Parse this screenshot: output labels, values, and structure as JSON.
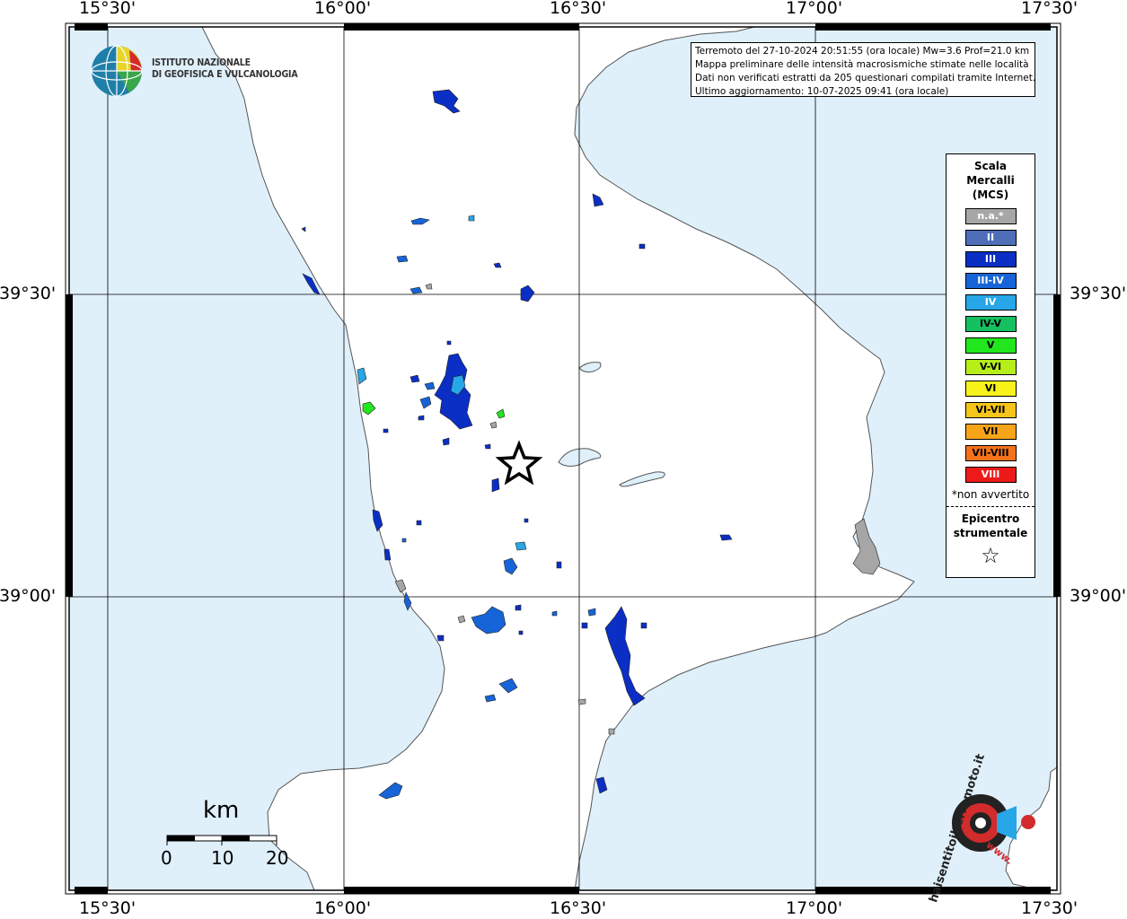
{
  "map": {
    "lon_labels": [
      "15°30'",
      "16°00'",
      "16°30'",
      "17°00'",
      "17°30'"
    ],
    "lat_labels": [
      "39°30'",
      "39°00'"
    ]
  },
  "info": {
    "line1": "Terremoto del 27-10-2024 20:51:55 (ora locale) Mw=3.6 Prof=21.0 km",
    "line2": "Mappa preliminare delle intensità macrosismiche stimate nelle località",
    "line3": "Dati non verificati estratti da 205 questionari compilati tramite Internet.",
    "line4": "Ultimo aggiornamento: 10-07-2025 09:41 (ora locale)"
  },
  "institute": {
    "line1": "ISTITUTO NAZIONALE",
    "line2": "DI GEOFISICA E VULCANOLOGIA"
  },
  "legend": {
    "title1": "Scala",
    "title2": "Mercalli",
    "title3": "(MCS)",
    "items": [
      {
        "label": "n.a.*",
        "color": "#a6a6a6",
        "text_color": "#ffffff"
      },
      {
        "label": "II",
        "color": "#4f6eb8",
        "text_color": "#ffffff"
      },
      {
        "label": "III",
        "color": "#0b2fc4",
        "text_color": "#ffffff"
      },
      {
        "label": "III-IV",
        "color": "#1764d8",
        "text_color": "#ffffff"
      },
      {
        "label": "IV",
        "color": "#27a6e8",
        "text_color": "#ffffff"
      },
      {
        "label": "IV-V",
        "color": "#14c060",
        "text_color": "#000000"
      },
      {
        "label": "V",
        "color": "#22e61e",
        "text_color": "#000000"
      },
      {
        "label": "V-VI",
        "color": "#b6ee1a",
        "text_color": "#000000"
      },
      {
        "label": "VI",
        "color": "#f6f21a",
        "text_color": "#000000"
      },
      {
        "label": "VI-VII",
        "color": "#f6c51a",
        "text_color": "#000000"
      },
      {
        "label": "VII",
        "color": "#f6a51a",
        "text_color": "#000000"
      },
      {
        "label": "VII-VIII",
        "color": "#f6721a",
        "text_color": "#000000"
      },
      {
        "label": "VIII",
        "color": "#ee1a1a",
        "text_color": "#ffffff"
      }
    ],
    "note": "*non avvertito",
    "epicenter1": "Epicentro",
    "epicenter2": "strumentale",
    "star": "☆"
  },
  "scalebar": {
    "unit": "km",
    "labels": [
      "0",
      "10",
      "20"
    ]
  },
  "badge": {
    "text": "haisentitoilterremoto.it",
    "www": "www."
  },
  "colors": {
    "sea": "#dff0fb",
    "land": "#ffffff",
    "frame": "#000000",
    "coast": "#555555"
  }
}
